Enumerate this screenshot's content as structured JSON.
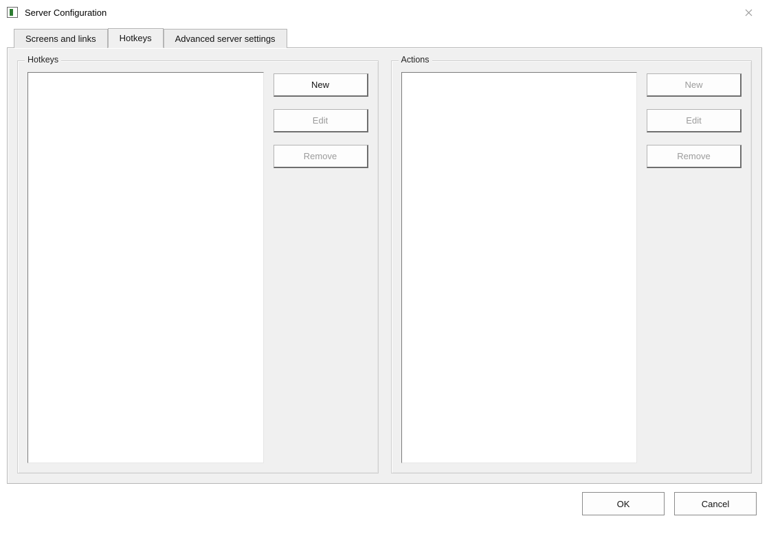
{
  "window": {
    "title": "Server Configuration"
  },
  "tabs": {
    "screens": "Screens and links",
    "hotkeys": "Hotkeys",
    "advanced": "Advanced server settings"
  },
  "groups": {
    "hotkeys": {
      "label": "Hotkeys",
      "buttons": {
        "new": "New",
        "edit": "Edit",
        "remove": "Remove"
      }
    },
    "actions": {
      "label": "Actions",
      "buttons": {
        "new": "New",
        "edit": "Edit",
        "remove": "Remove"
      }
    }
  },
  "footer": {
    "ok": "OK",
    "cancel": "Cancel"
  }
}
